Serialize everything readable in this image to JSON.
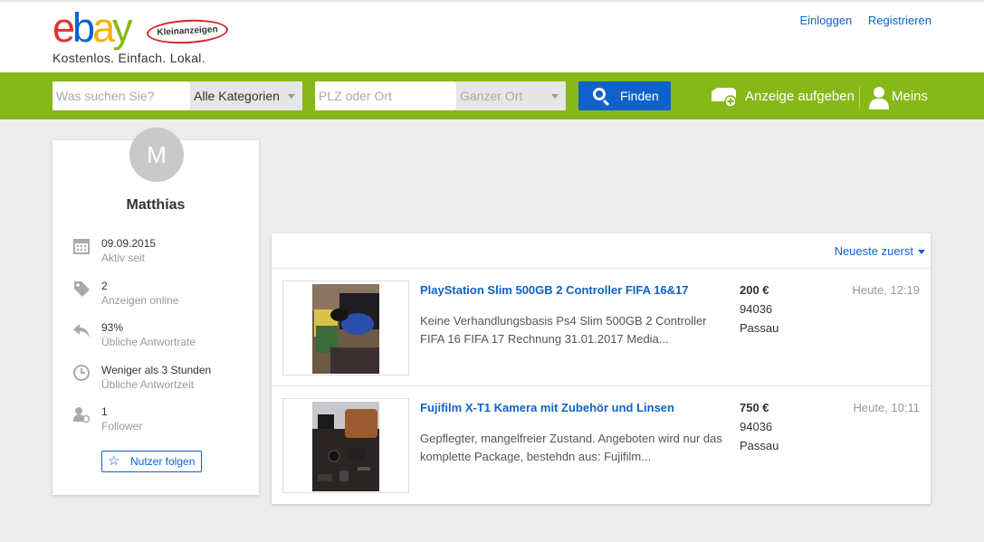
{
  "header": {
    "logo_letters": [
      "e",
      "b",
      "a",
      "y"
    ],
    "badge": "Kleinanzeigen",
    "tagline": "Kostenlos. Einfach. Lokal.",
    "login": "Einloggen",
    "register": "Registrieren"
  },
  "search": {
    "query_placeholder": "Was suchen Sie?",
    "category": "Alle Kategorien",
    "location_placeholder": "PLZ oder Ort",
    "radius": "Ganzer Ort",
    "find_label": "Finden",
    "post_ad_label": "Anzeige aufgeben",
    "account_label": "Meins"
  },
  "colors": {
    "green_bar": "#86b817",
    "link_blue": "#0f62c9"
  },
  "profile": {
    "initial": "M",
    "name": "Matthias",
    "stats": [
      {
        "icon": "calendar-icon",
        "value": "09.09.2015",
        "label": "Aktiv seit"
      },
      {
        "icon": "tag-icon",
        "value": "2",
        "label": "Anzeigen online"
      },
      {
        "icon": "reply-icon",
        "value": "93%",
        "label": "Übliche Antwortrate"
      },
      {
        "icon": "clock-icon",
        "value": "Weniger als 3 Stunden",
        "label": "Übliche Antwortzeit"
      },
      {
        "icon": "follower-icon",
        "value": "1",
        "label": "Follower"
      }
    ],
    "follow_label": "Nutzer folgen"
  },
  "results": {
    "sort_label": "Neueste zuerst",
    "items": [
      {
        "title": "PlayStation Slim 500GB 2 Controller FIFA 16&17",
        "description": "Keine Verhandlungsbasis Ps4 Slim 500GB 2 Controller FIFA 16 FIFA 17 Rechnung 31.01.2017 Media...",
        "price": "200 €",
        "zip": "94036",
        "city": "Passau",
        "date": "Heute, 12:19"
      },
      {
        "title": "Fujifilm X-T1 Kamera mit Zubehör und Linsen",
        "description": "Gepflegter, mangelfreier Zustand. Angeboten wird nur das komplette Package, bestehdn aus: Fujifilm...",
        "price": "750 €",
        "zip": "94036",
        "city": "Passau",
        "date": "Heute, 10:11"
      }
    ]
  }
}
